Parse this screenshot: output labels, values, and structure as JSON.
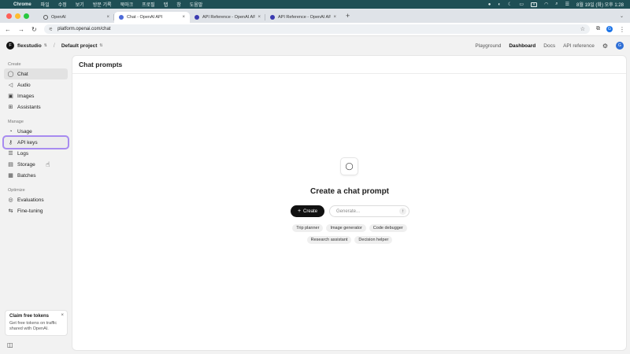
{
  "menubar": {
    "app": "Chrome",
    "menus": [
      "파일",
      "수정",
      "보기",
      "방문 기록",
      "북마크",
      "프로필",
      "탭",
      "창",
      "도움말"
    ],
    "datetime": "8월 19일 (화) 오후 1:28",
    "input_badge": "A"
  },
  "tabs": [
    {
      "title": "OpenAI",
      "active": false,
      "favicon": "openai-icon"
    },
    {
      "title": "Chat - OpenAI API",
      "active": true,
      "favicon": "openai-icon"
    },
    {
      "title": "API Reference - OpenAI API",
      "active": false,
      "favicon": "openai-icon"
    },
    {
      "title": "API Reference - OpenAI API",
      "active": false,
      "favicon": "openai-icon"
    }
  ],
  "address": {
    "url": "platform.openai.com/chat"
  },
  "profile_initial": "G",
  "topnav": {
    "org_initial": "F",
    "org": "flexstudio",
    "project": "Default project",
    "links": [
      {
        "label": "Playground",
        "active": false
      },
      {
        "label": "Dashboard",
        "active": true
      },
      {
        "label": "Docs",
        "active": false
      },
      {
        "label": "API reference",
        "active": false
      }
    ],
    "user_initial": "G"
  },
  "sidebar": {
    "create_label": "Create",
    "create_items": [
      {
        "label": "Chat",
        "icon": "chat-bubble-icon",
        "active": true
      },
      {
        "label": "Audio",
        "icon": "speaker-icon"
      },
      {
        "label": "Images",
        "icon": "image-icon"
      },
      {
        "label": "Assistants",
        "icon": "assistants-icon"
      }
    ],
    "manage_label": "Manage",
    "manage_items": [
      {
        "label": "Usage",
        "icon": "usage-icon"
      },
      {
        "label": "API keys",
        "icon": "key-icon",
        "highlight": true
      },
      {
        "label": "Logs",
        "icon": "logs-icon"
      },
      {
        "label": "Storage",
        "icon": "storage-icon"
      },
      {
        "label": "Batches",
        "icon": "batches-icon"
      }
    ],
    "optimize_label": "Optimize",
    "optimize_items": [
      {
        "label": "Evaluations",
        "icon": "evaluations-icon"
      },
      {
        "label": "Fine-tuning",
        "icon": "fine-tuning-icon"
      }
    ],
    "promo": {
      "title": "Claim free tokens",
      "text": "Get free tokens on traffic shared with OpenAI."
    }
  },
  "main": {
    "title": "Chat prompts",
    "heading": "Create a chat prompt",
    "create_label": "Create",
    "input_placeholder": "Generate...",
    "chips_row1": [
      "Trip planner",
      "Image generator",
      "Code debugger"
    ],
    "chips_row2": [
      "Research assistant",
      "Decision helper"
    ]
  },
  "colors": {
    "accent_highlight": "#a78bf0",
    "primary_button": "#111111",
    "mac_bar": "#1f4f55"
  }
}
